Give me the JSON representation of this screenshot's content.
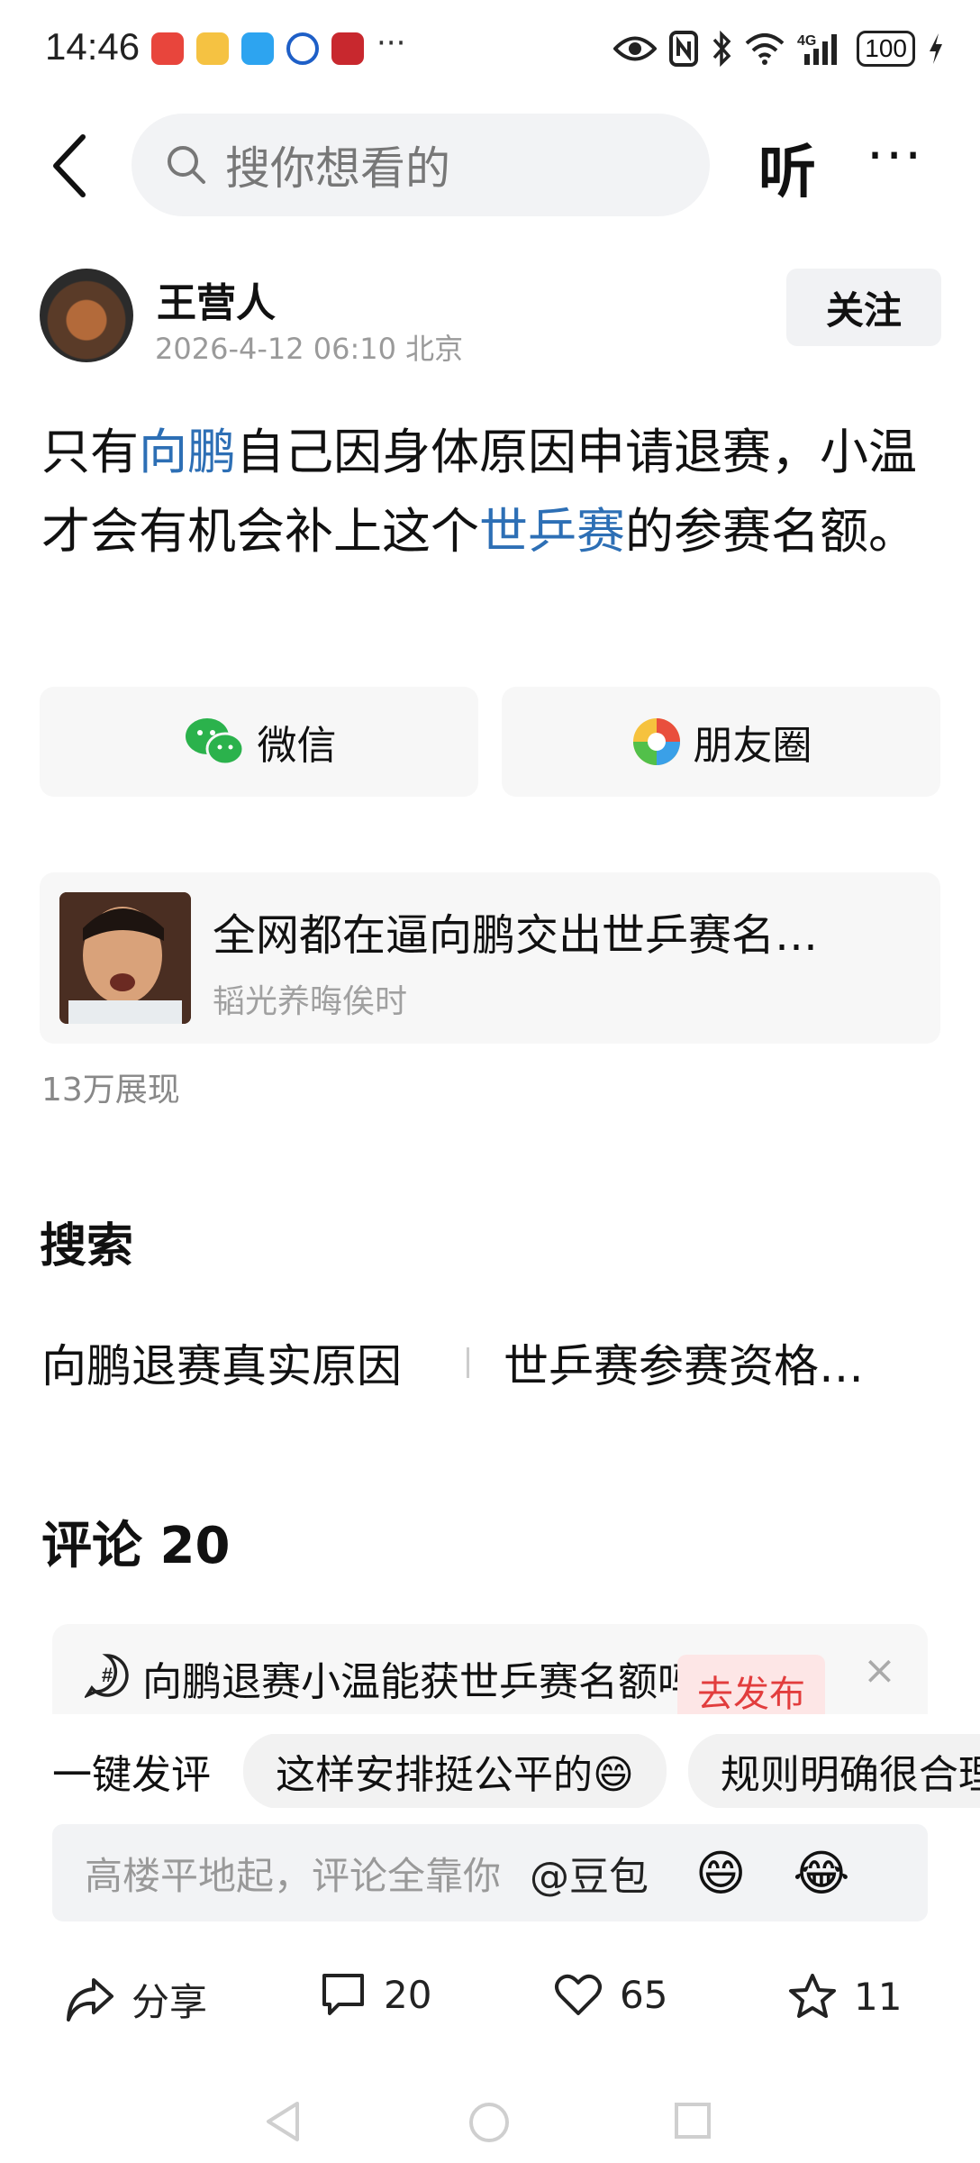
{
  "status_bar": {
    "time": "14:46",
    "dots": "···",
    "network": "4G",
    "battery": "100"
  },
  "top_bar": {
    "search_placeholder": "搜你想看的",
    "listen_label": "听",
    "more_label": "···"
  },
  "author": {
    "name": "王营人",
    "meta": "2026-4-12 06:10 北京",
    "follow_label": "关注"
  },
  "post": {
    "segments": [
      {
        "text": "只有",
        "link": false
      },
      {
        "text": "向鹏",
        "link": true
      },
      {
        "text": "自己因身体原因申请退赛，小温才会有机会补上这个",
        "link": false
      },
      {
        "text": "世乒赛",
        "link": true
      },
      {
        "text": "的参赛名额。",
        "link": false
      }
    ]
  },
  "share": {
    "wechat_label": "微信",
    "moments_label": "朋友圈"
  },
  "related": {
    "title": "全网都在逼向鹏交出世乒赛名…",
    "source": "韬光养晦俟时"
  },
  "impressions": "13万展现",
  "search_section": {
    "title": "搜索",
    "tags": [
      "向鹏退赛真实原因",
      "世乒赛参赛资格…"
    ]
  },
  "comments": {
    "title": "评论 20",
    "topic_text": "向鹏退赛小温能获世乒赛名额吗",
    "publish_label": "去发布",
    "close_label": "×",
    "quick_label": "一键发评",
    "quick_chips": [
      "这样安排挺公平的😄",
      "规则明确很合理"
    ],
    "input_placeholder": "高楼平地起，评论全靠你",
    "mention": "@豆包",
    "emoji_1": "😄",
    "emoji_2": "😂"
  },
  "actions": {
    "share_label": "分享",
    "comment_count": "20",
    "like_count": "65",
    "favorite_count": "11"
  }
}
